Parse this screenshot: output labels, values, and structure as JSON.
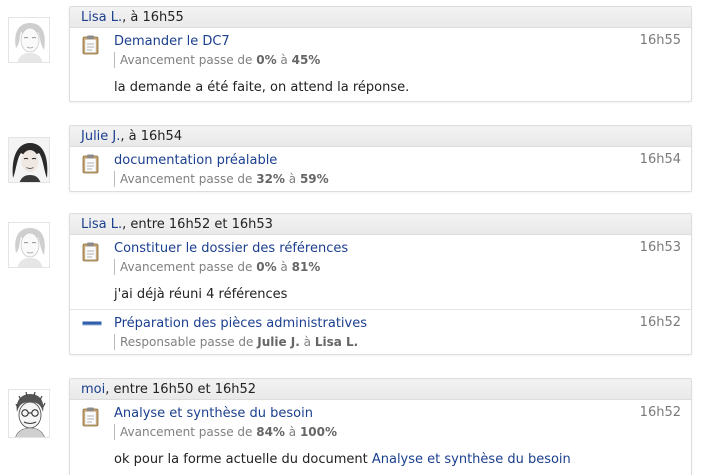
{
  "groups": [
    {
      "avatar": "female-avatar-lisa",
      "user": "Lisa L.",
      "when": ", à 16h55",
      "entries": [
        {
          "icon": "clipboard-icon",
          "title": "Demander le DC7",
          "time": "16h55",
          "change_prefix": "Avancement passe de ",
          "from": "0%",
          "connector": " à ",
          "to": "45%",
          "comment": "la demande a été faite, on attend la réponse."
        }
      ]
    },
    {
      "avatar": "female-avatar-julie",
      "user": "Julie J.",
      "when": ", à 16h54",
      "entries": [
        {
          "icon": "clipboard-icon",
          "title": "documentation préalable",
          "time": "16h54",
          "change_prefix": "Avancement passe de ",
          "from": "32%",
          "connector": " à ",
          "to": "59%"
        }
      ]
    },
    {
      "avatar": "female-avatar-lisa",
      "user": "Lisa L.",
      "when": ", entre 16h52 et 16h53",
      "entries": [
        {
          "icon": "clipboard-icon",
          "title": "Constituer le dossier des références",
          "time": "16h53",
          "change_prefix": "Avancement passe de ",
          "from": "0%",
          "connector": " à ",
          "to": "81%",
          "comment": "j'ai déjà réuni 4 références"
        },
        {
          "icon": "task-bar-icon",
          "title": "Préparation des pièces administratives",
          "time": "16h52",
          "change_prefix": "Responsable passe de ",
          "from": "Julie J.",
          "connector": " à ",
          "to": "Lisa L."
        }
      ]
    },
    {
      "avatar": "male-avatar-moi",
      "user": "moi",
      "when": ", entre 16h50 et 16h52",
      "entries": [
        {
          "icon": "clipboard-icon",
          "title": "Analyse et synthèse du besoin",
          "time": "16h52",
          "change_prefix": "Avancement passe de ",
          "from": "84%",
          "connector": " à ",
          "to": "100%",
          "comment": "ok pour la forme actuelle du document ",
          "comment_link": "Analyse et synthèse du besoin"
        }
      ]
    }
  ]
}
